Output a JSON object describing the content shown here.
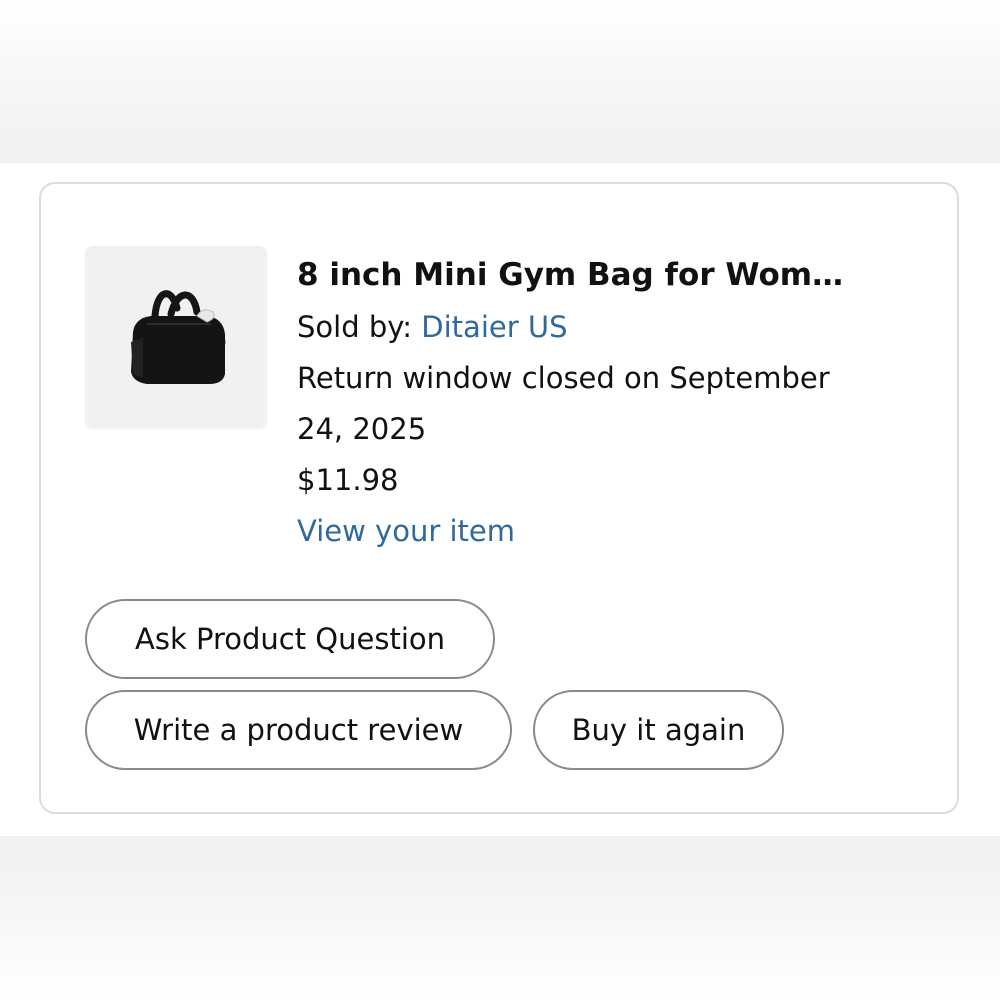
{
  "order_item": {
    "title": "8 inch Mini Gym Bag for Wom…",
    "sold_by_label": "Sold by: ",
    "seller": "Ditaier US",
    "return_line_1": "Return window closed on September",
    "return_line_2": "24, 2025",
    "price": "$11.98",
    "view_item_link": "View your item",
    "image_icon": "black-gym-bag-product-photo"
  },
  "actions": {
    "ask_question": "Ask Product Question",
    "write_review": "Write a product review",
    "buy_again": "Buy it again"
  },
  "colors": {
    "link": "#2f6a9b",
    "text": "#111111",
    "button_border": "#8a8a8a",
    "card_border": "#dcdcdc"
  }
}
